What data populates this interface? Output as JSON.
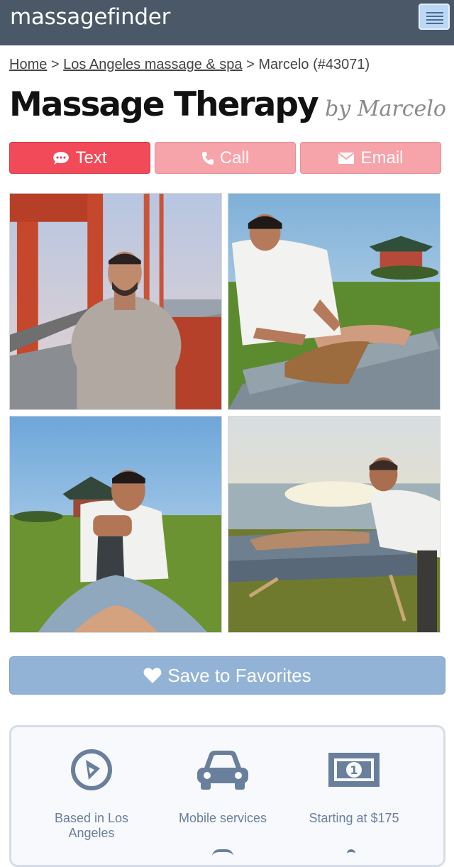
{
  "header": {
    "logo": "massagefinder",
    "menu_icon": "hamburger-menu-icon"
  },
  "breadcrumb": {
    "home": "Home",
    "separator": ">",
    "category": "Los Angeles massage & spa",
    "current": "Marcelo (#43071)"
  },
  "listing": {
    "title": "Massage Therapy",
    "byline": "by Marcelo"
  },
  "actions": {
    "text_label": "Text",
    "call_label": "Call",
    "email_label": "Email"
  },
  "photos": [
    {
      "icon": "photo-therapist-on-bridge"
    },
    {
      "icon": "photo-shoulder-massage-outdoors"
    },
    {
      "icon": "photo-leg-stretch-outdoors"
    },
    {
      "icon": "photo-massage-at-seaside-sunset"
    }
  ],
  "favorites": {
    "label": "Save to Favorites"
  },
  "features": [
    {
      "label": "Based in Los Angeles",
      "icon": "location-compass-icon"
    },
    {
      "label": "Mobile services",
      "icon": "car-icon"
    },
    {
      "label": "Starting at $175",
      "icon": "dollar-bill-icon"
    }
  ],
  "colors": {
    "header_bg": "#4a5868",
    "text_button": "#f24a59",
    "secondary_button": "#f7a3aa",
    "favorites_button": "#92b3d6",
    "feature_accent": "#6a7f9c"
  }
}
